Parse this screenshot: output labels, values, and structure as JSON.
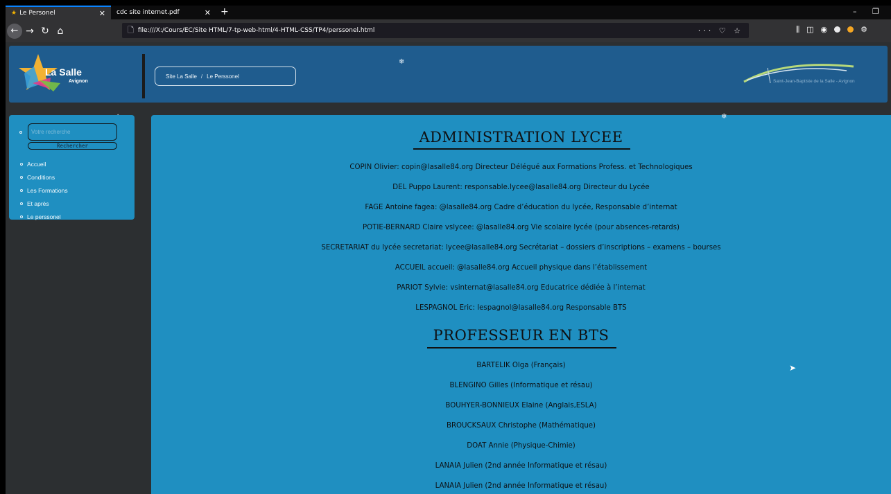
{
  "browser": {
    "tabs": [
      {
        "label": "Le Personel",
        "icon": "star-icon",
        "active": true
      },
      {
        "label": "cdc site internet.pdf",
        "icon": "pdf-icon",
        "active": false
      }
    ],
    "url": "file:///X:/Cours/EC/Site HTML/7-tp-web-html/4-HTML-CSS/TP4/perssonel.html"
  },
  "header": {
    "logo_text": "La Salle",
    "logo_sub": "Avignon",
    "breadcrumb": [
      "Site La Salle",
      "Le Perssonel"
    ],
    "breadcrumb_sep": "/",
    "partner_text": "Saint-Jean-Baptiste de la Salle - Avignon"
  },
  "sidebar": {
    "search_placeholder": "Votre recherche",
    "search_button": "Rechercher",
    "menu": [
      "Accueil",
      "Conditions",
      "Les Formations",
      "Et après",
      "Le perssonel"
    ]
  },
  "content": {
    "admin_title": "ADMINISTRATION LYCEE",
    "admin_entries": [
      "COPIN Olivier: copin@lasalle84.org Directeur Délégué aux Formations Profess. et Technologiques",
      "DEL Puppo Laurent: responsable.lycee@lasalle84.org Directeur du Lycée",
      "FAGE Antoine fagea: @lasalle84.org Cadre d’éducation du lycée, Responsable d’internat",
      "POTIE-BERNARD Claire vslycee: @lasalle84.org Vie scolaire lycée (pour absences-retards)",
      "SECRETARIAT du lycée secretariat: lycee@lasalle84.org Secrétariat – dossiers d’inscriptions – examens – bourses",
      "ACCUEIL accueil: @lasalle84.org Accueil physique dans l’établissement",
      "PARIOT Sylvie: vsinternat@lasalle84.org Educatrice dédiée à l’internat",
      "LESPAGNOL Eric: lespagnol@lasalle84.org Responsable BTS"
    ],
    "bts_title": "PROFESSEUR EN BTS",
    "bts_entries": [
      "BARTELIK Olga (Français)",
      "BLENGINO Gilles (Informatique et résau)",
      "BOUHYER-BONNIEUX Elaine (Anglais,ESLA)",
      "BROUCKSAUX Christophe (Mathématique)",
      "DOAT Annie (Physique-Chimie)",
      "LANAIA Julien (2nd année Informatique et résau)",
      "LANAIA Julien (2nd année Informatique et résau)"
    ]
  }
}
